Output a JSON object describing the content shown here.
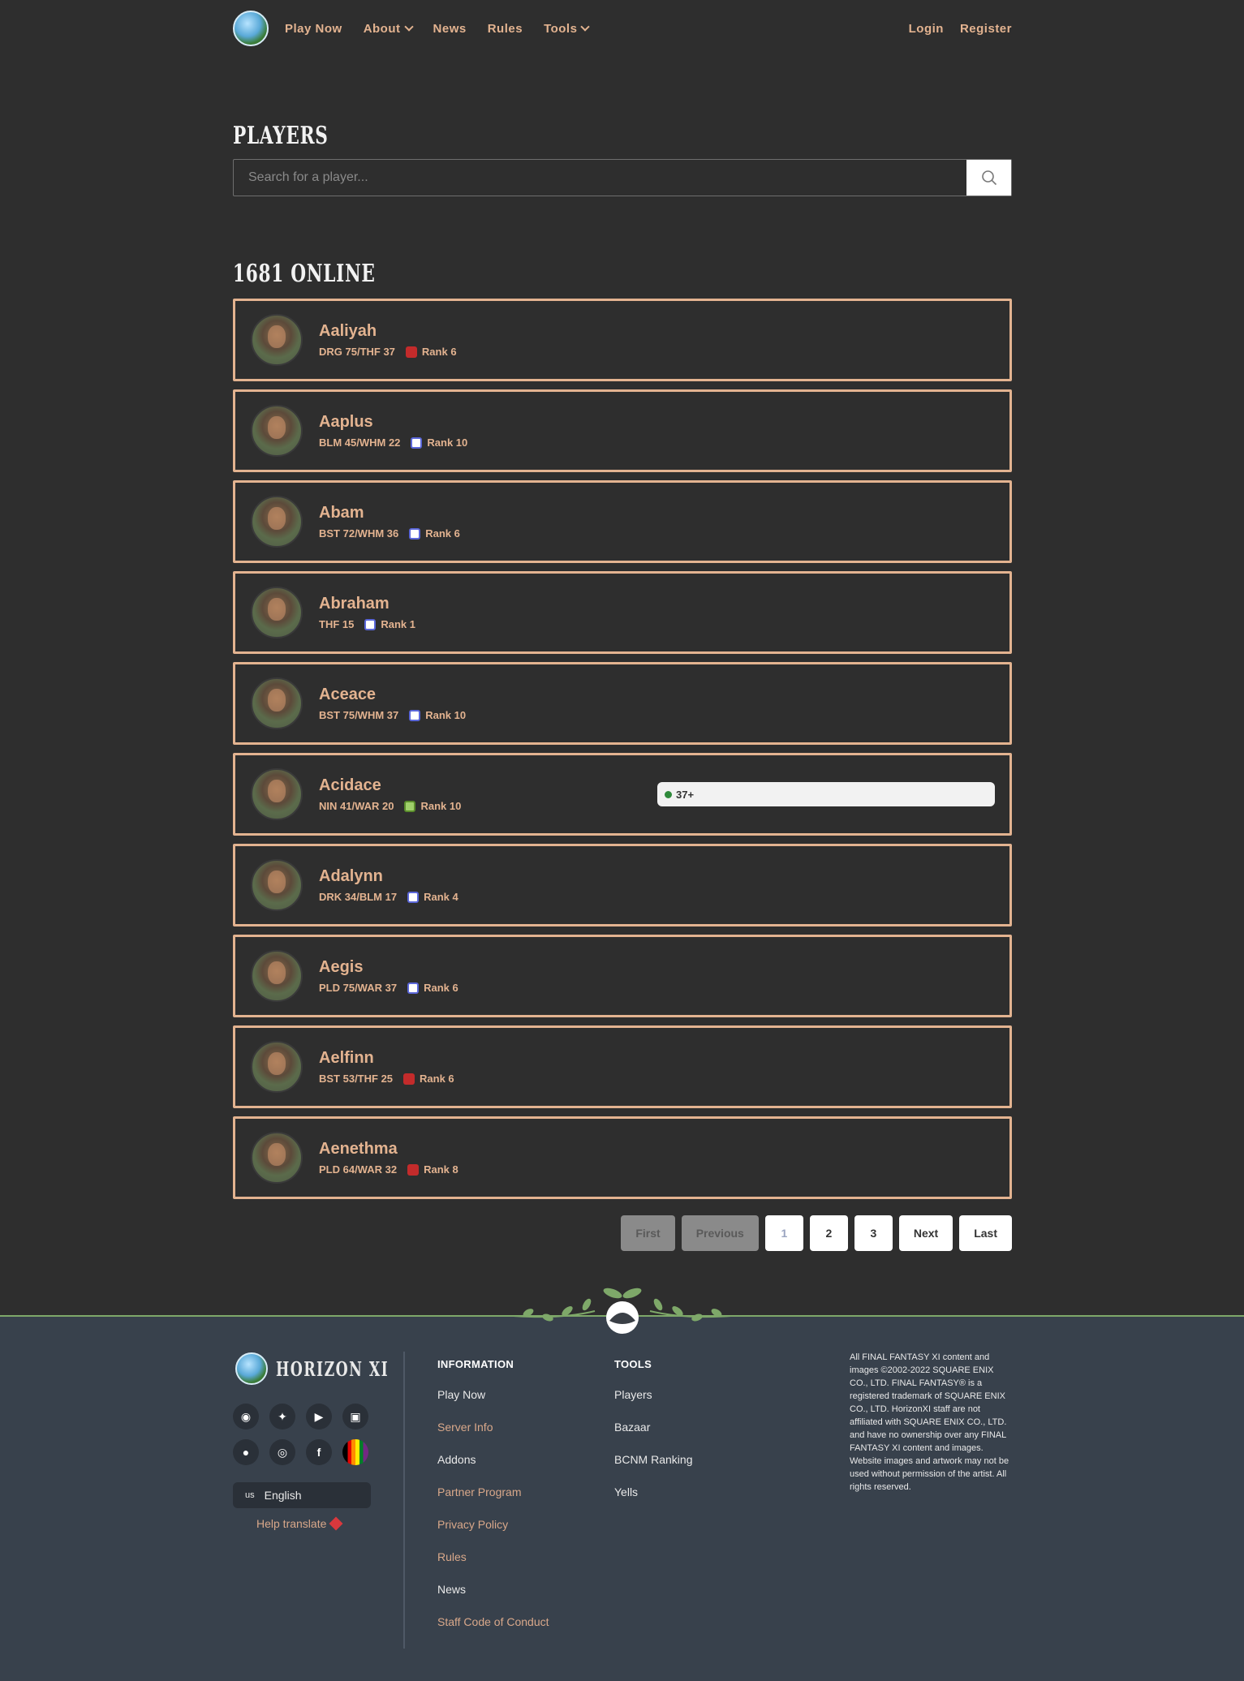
{
  "nav": {
    "links": [
      {
        "label": "Play Now",
        "dropdown": false
      },
      {
        "label": "About",
        "dropdown": true
      },
      {
        "label": "News",
        "dropdown": false
      },
      {
        "label": "Rules",
        "dropdown": false
      },
      {
        "label": "Tools",
        "dropdown": true
      }
    ],
    "login": "Login",
    "register": "Register"
  },
  "page": {
    "title": "PLAYERS",
    "search_placeholder": "Search for a player...",
    "online_heading": "1681 ONLINE"
  },
  "players": [
    {
      "name": "Aaliyah",
      "jobs": "DRG 75/THF 37",
      "nation": "red",
      "rank": "Rank 6"
    },
    {
      "name": "Aaplus",
      "jobs": "BLM 45/WHM 22",
      "nation": "blue",
      "rank": "Rank 10"
    },
    {
      "name": "Abam",
      "jobs": "BST 72/WHM 36",
      "nation": "blue",
      "rank": "Rank 6"
    },
    {
      "name": "Abraham",
      "jobs": "THF 15",
      "nation": "blue",
      "rank": "Rank 1"
    },
    {
      "name": "Aceace",
      "jobs": "BST 75/WHM 37",
      "nation": "blue",
      "rank": "Rank 10"
    },
    {
      "name": "Acidace",
      "jobs": "NIN 41/WAR 20",
      "nation": "green",
      "rank": "Rank 10",
      "activity": "37+"
    },
    {
      "name": "Adalynn",
      "jobs": "DRK 34/BLM 17",
      "nation": "blue",
      "rank": "Rank 4"
    },
    {
      "name": "Aegis",
      "jobs": "PLD 75/WAR 37",
      "nation": "blue",
      "rank": "Rank 6"
    },
    {
      "name": "Aelfinn",
      "jobs": "BST 53/THF 25",
      "nation": "red",
      "rank": "Rank 6"
    },
    {
      "name": "Aenethma",
      "jobs": "PLD 64/WAR 32",
      "nation": "red",
      "rank": "Rank 8"
    }
  ],
  "pagination": {
    "first": "First",
    "previous": "Previous",
    "pages": [
      "1",
      "2",
      "3"
    ],
    "current": "1",
    "next": "Next",
    "last": "Last"
  },
  "footer": {
    "brand": "HORIZON XI",
    "socials": [
      "discord-icon",
      "twitter-icon",
      "youtube-icon",
      "twitch-icon",
      "reddit-icon",
      "instagram-icon",
      "facebook-icon",
      "pride-flag-icon"
    ],
    "language": {
      "code": "us",
      "label": "English"
    },
    "help_translate": "Help translate",
    "info_heading": "INFORMATION",
    "info_links": [
      {
        "label": "Play Now",
        "muted": false
      },
      {
        "label": "Server Info",
        "muted": true
      },
      {
        "label": "Addons",
        "muted": false
      },
      {
        "label": "Partner Program",
        "muted": true
      },
      {
        "label": "Privacy Policy",
        "muted": true
      },
      {
        "label": "Rules",
        "muted": true
      },
      {
        "label": "News",
        "muted": false
      },
      {
        "label": "Staff Code of Conduct",
        "muted": true
      }
    ],
    "tools_heading": "TOOLS",
    "tools_links": [
      "Players",
      "Bazaar",
      "BCNM Ranking",
      "Yells"
    ],
    "legal": "All FINAL FANTASY XI content and images ©2002-2022 SQUARE ENIX CO., LTD. FINAL FANTASY® is a registered trademark of SQUARE ENIX CO., LTD. HorizonXI staff are not affiliated with SQUARE ENIX CO., LTD. and have no ownership over any FINAL FANTASY XI content and images. Website images and artwork may not be used without permission of the artist. All rights reserved."
  },
  "colors": {
    "accent": "#e3b390",
    "background": "#2e2e2e",
    "footer": "#38414c",
    "footer_line": "#7ea869"
  }
}
